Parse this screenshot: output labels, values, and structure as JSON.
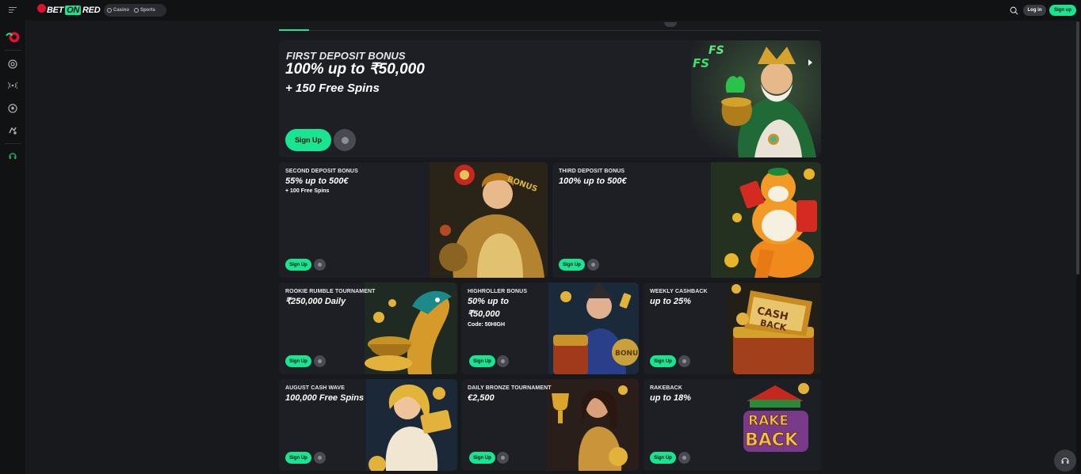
{
  "header": {
    "logo": {
      "pre": "BET",
      "mid": "ON",
      "post": "RED"
    },
    "switch": {
      "casino": "Casino",
      "sports": "Sports"
    },
    "login_label": "Log in",
    "signup_label": "Sign up"
  },
  "sidebar": {
    "icons": [
      "roulette-icon",
      "casino-chip-icon",
      "live-broadcast-icon",
      "football-icon",
      "sports-icon",
      "support-icon"
    ]
  },
  "hero": {
    "title": "FIRST DEPOSIT BONUS",
    "headline": "100% up to ₹50,000",
    "sub": "+ 150 Free Spins",
    "cta": "Sign Up"
  },
  "promos_row1": [
    {
      "title": "SECOND DEPOSIT BONUS",
      "headline": "55% up to 500€",
      "sub": "+ 100 Free Spins",
      "cta": "Sign Up"
    },
    {
      "title": "THIRD DEPOSIT BONUS",
      "headline": "100% up to 500€",
      "sub": "",
      "cta": "Sign Up"
    }
  ],
  "promos_row2": [
    {
      "title": "ROOKIE RUMBLE TOURNAMENT",
      "headline": "₹250,000 Daily",
      "sub": "",
      "cta": "Sign Up"
    },
    {
      "title": "HIGHROLLER BONUS",
      "headline": "50% up to",
      "headline2": "₹50,000",
      "sub": "Code: 50HIGH",
      "cta": "Sign Up"
    },
    {
      "title": "WEEKLY CASHBACK",
      "headline": "up to 25%",
      "sub": "",
      "cta": "Sign Up"
    }
  ],
  "promos_row3": [
    {
      "title": "AUGUST CASH WAVE",
      "headline": "100,000 Free Spins",
      "sub": "",
      "cta": "Sign Up"
    },
    {
      "title": "DAILY BRONZE TOURNAMENT",
      "headline": "€2,500",
      "sub": "",
      "cta": "Sign Up"
    },
    {
      "title": "RAKEBACK",
      "headline": "up to 18%",
      "sub": "",
      "cta": "Sign Up"
    }
  ],
  "art_text": {
    "fs": "FS",
    "bonus": "BONUS",
    "cashback1": "CASH",
    "cashback2": "BACK",
    "rake": "RAKE",
    "back": "BACK"
  },
  "colors": {
    "accent": "#19e48f",
    "brand_red": "#e0122f",
    "card_bg": "#1e1f24",
    "page_bg": "#111214"
  }
}
